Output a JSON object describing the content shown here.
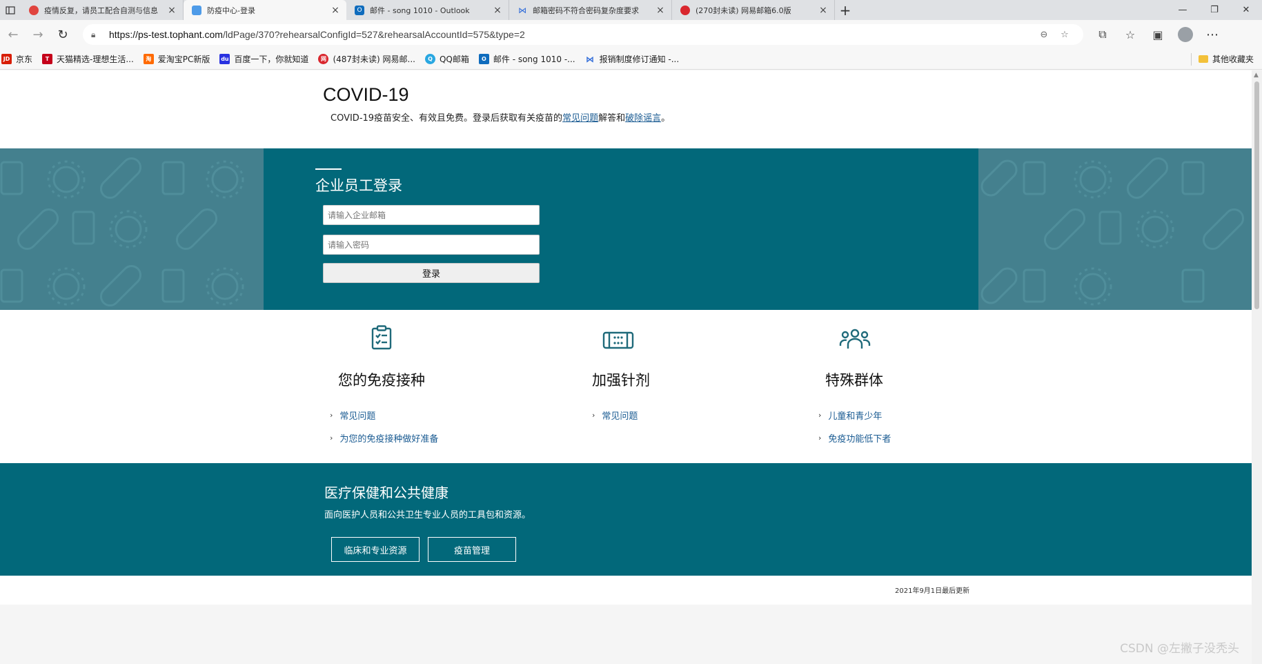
{
  "browser": {
    "tabs": [
      {
        "title": "疫情反复，请员工配合自测与信息",
        "favicon_color": "#e0443e",
        "active": false
      },
      {
        "title": "防疫中心-登录",
        "favicon_color": "#4e9be8",
        "active": true
      },
      {
        "title": "邮件 - song 1010 - Outlook",
        "favicon_color": "#0f6cbd",
        "active": false
      },
      {
        "title": "邮箱密码不符合密码复杂度要求",
        "favicon_color": "#2f6bd9",
        "active": false
      },
      {
        "title": "(270封未读) 网易邮箱6.0版",
        "favicon_color": "#d9272e",
        "active": false
      }
    ],
    "address": {
      "url_host": "https://ps-test.tophant.com",
      "url_path": "/ldPage/370?rehearsalConfigId=527&rehearsalAccountId=575&type=2"
    },
    "bookmarks": [
      {
        "label": "京东",
        "icon": "JD",
        "color": "#d81e06"
      },
      {
        "label": "天猫精选-理想生活...",
        "icon": "T",
        "color": "#c5001a"
      },
      {
        "label": "爱淘宝PC新版",
        "icon": "淘",
        "color": "#ff6a00"
      },
      {
        "label": "百度一下，你就知道",
        "icon": "du",
        "color": "#2932e1"
      },
      {
        "label": "(487封未读) 网易邮...",
        "icon": "网",
        "color": "#d9272e"
      },
      {
        "label": "QQ邮箱",
        "icon": "Q",
        "color": "#29a7e1"
      },
      {
        "label": "邮件 - song 1010 -...",
        "icon": "O",
        "color": "#0f6cbd"
      },
      {
        "label": "报销制度修订通知 -...",
        "icon": "M",
        "color": "#2f6bd9"
      }
    ],
    "other_bookmarks": "其他收藏夹"
  },
  "hero": {
    "title": "COVID-19",
    "subtitle_pre": "COVID-19疫苗安全、有效且免费。登录后获取有关疫苗的",
    "link_faq": "常见问题",
    "subtitle_mid": "解答和",
    "link_rumor": "破除谣言",
    "subtitle_post": "。"
  },
  "login": {
    "title": "企业员工登录",
    "email_placeholder": "请输入企业邮箱",
    "password_placeholder": "请输入密码",
    "submit": "登录"
  },
  "features": [
    {
      "title": "您的免疫接种",
      "icon": "clipboard-check-icon",
      "links": [
        "常见问题",
        "为您的免疫接种做好准备"
      ]
    },
    {
      "title": "加强针剂",
      "icon": "ticket-icon",
      "links": [
        "常见问题"
      ]
    },
    {
      "title": "特殊群体",
      "icon": "people-group-icon",
      "links": [
        "儿童和青少年",
        "免疫功能低下者"
      ]
    }
  ],
  "health": {
    "title": "医疗保健和公共健康",
    "subtitle": "面向医护人员和公共卫生专业人员的工具包和资源。",
    "button_clinical": "临床和专业资源",
    "button_vaccine": "疫苗管理"
  },
  "footer": {
    "updated": "2021年9月1日最后更新"
  },
  "watermark": "CSDN @左撇子没秃头",
  "colors": {
    "brand_teal": "#02687a",
    "pattern_teal": "#44808e",
    "link_blue": "#1a5b92"
  }
}
